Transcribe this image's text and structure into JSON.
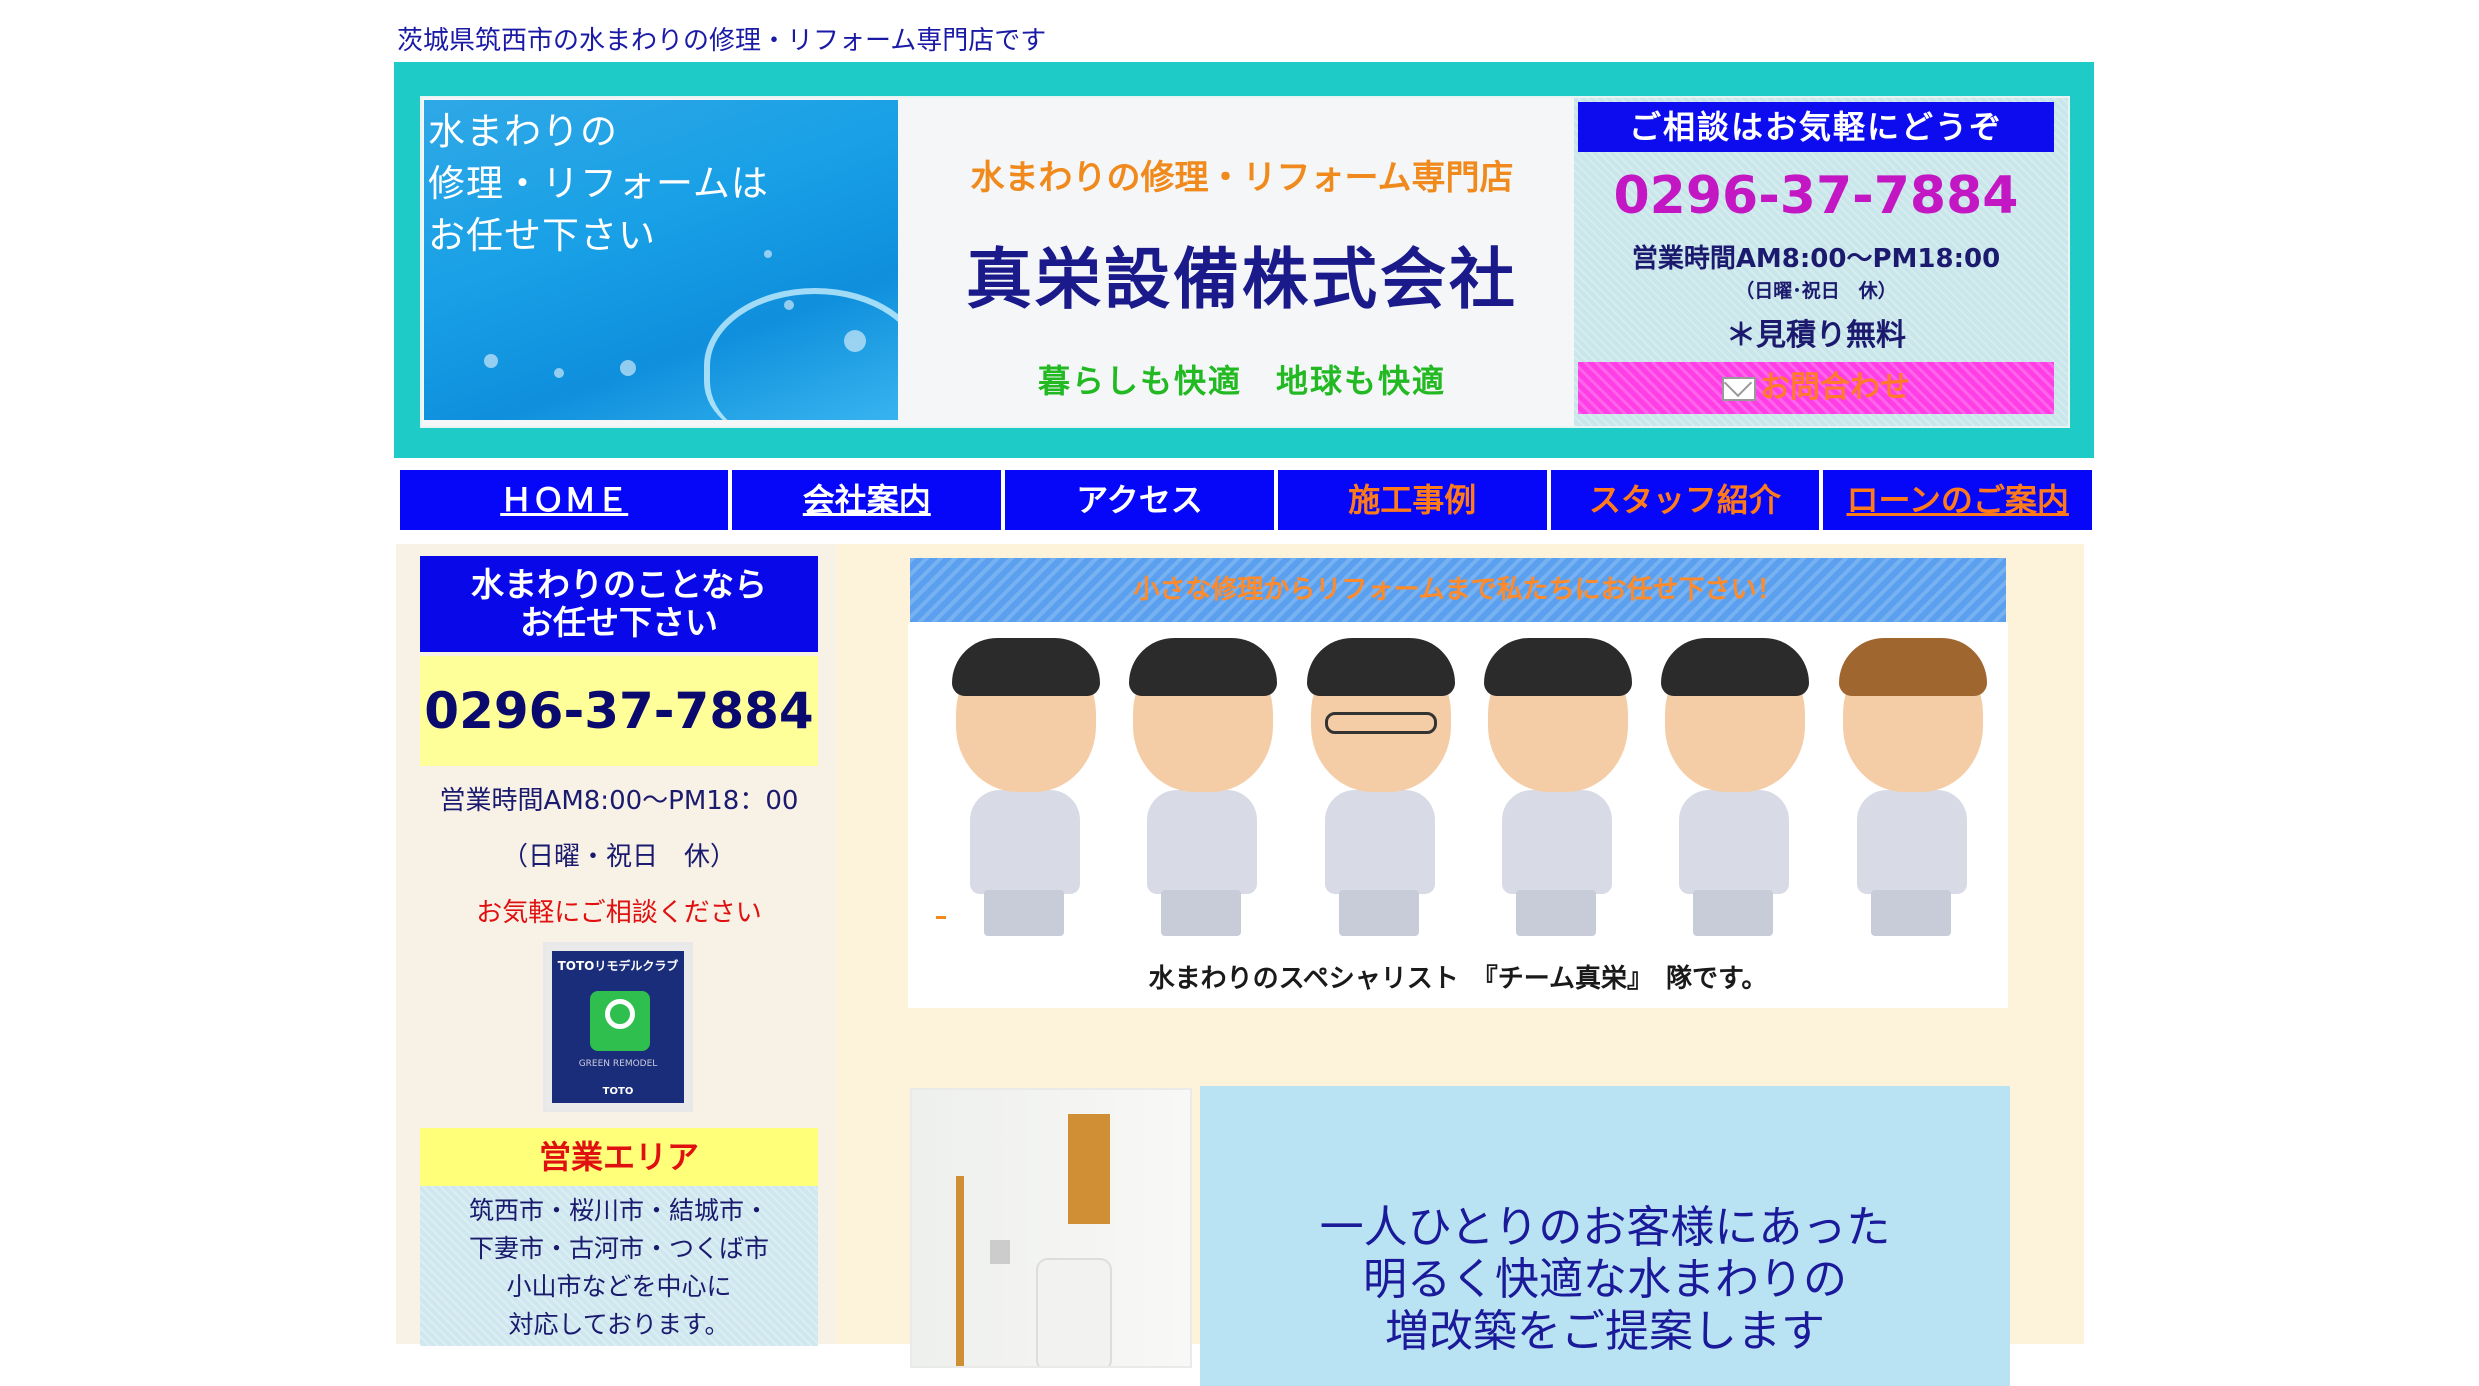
{
  "tagline": "茨城県筑西市の水まわりの修理・リフォーム専門店です",
  "header": {
    "water_lines": [
      "水まわりの",
      "修理・リフォームは",
      "お任せ下さい"
    ],
    "subtitle": "水まわりの修理・リフォーム専門店",
    "company": "真栄設備株式会社",
    "slogan": "暮らしも快適　地球も快適",
    "contact": {
      "heading": "ご相談はお気軽にどうぞ",
      "phone": "0296-37-7884",
      "hours": "営業時間AM8:00〜PM18:00",
      "closed": "（日曜･祝日　休）",
      "estimate": "＊見積り無料",
      "button": "お問合わせ"
    }
  },
  "nav": [
    {
      "label": "ＨＯＭＥ",
      "color": "#ffffff",
      "underline": true
    },
    {
      "label": "会社案内",
      "color": "#ffffff",
      "underline": true
    },
    {
      "label": "アクセス",
      "color": "#ffffff",
      "underline": false
    },
    {
      "label": "施工事例",
      "color": "#ff7a1a",
      "underline": false
    },
    {
      "label": "スタッフ紹介",
      "color": "#ff7a1a",
      "underline": false
    },
    {
      "label": "ローンのご案内",
      "color": "#ff7a1a",
      "underline": true
    }
  ],
  "sidebar": {
    "heading": [
      "水まわりのことなら",
      "お任せ下さい"
    ],
    "phone": "0296-37-7884",
    "hours": "営業時間AM8:00〜PM18：00",
    "closed": "（日曜・祝日　休）",
    "consult": "お気軽にご相談ください",
    "badge": {
      "title": "TOTOリモデルクラブ",
      "caption": "GREEN REMODEL",
      "foot": "TOTO"
    },
    "area_heading": "営業エリア",
    "area_lines": [
      "筑西市・桜川市・結城市・",
      "下妻市・古河市・つくば市",
      "小山市などを中心に",
      "対応しております。"
    ]
  },
  "main": {
    "banner": "小さな修理からリフォームまで私たちにお任せ下さい！",
    "team_caption": "水まわりのスペシャリスト　『チーム真栄』　隊です。",
    "promo_lines": [
      "一人ひとりのお客様にあった",
      "明るく快適な水まわりの",
      "増改築をご提案します"
    ]
  },
  "colors": {
    "accent": "#1ecbc6",
    "nav": "#0606f8",
    "phone": "#c417c4"
  }
}
